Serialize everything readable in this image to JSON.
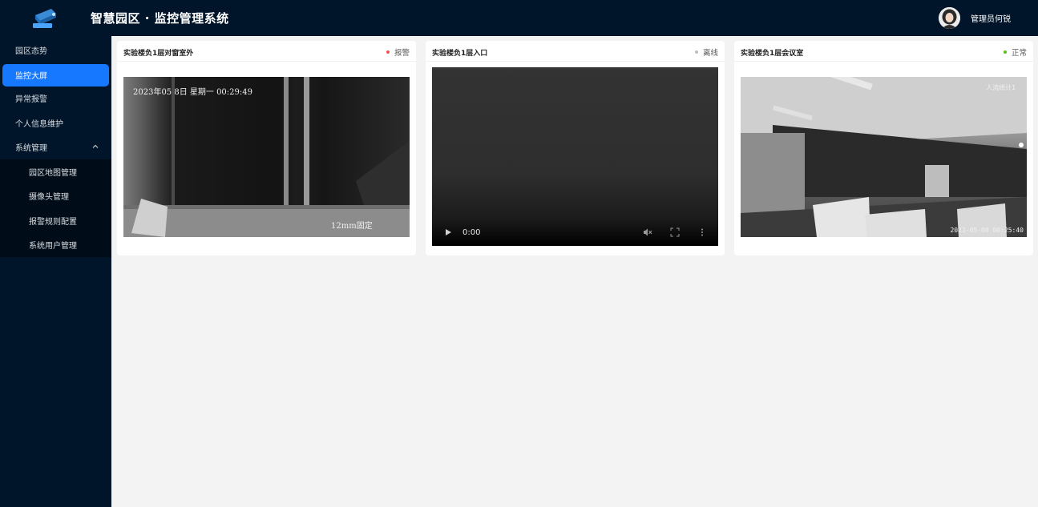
{
  "header": {
    "title": "智慧园区 · 监控管理系统",
    "user_name": "管理员何锐"
  },
  "sidebar": {
    "items": [
      {
        "label": "园区态势"
      },
      {
        "label": "监控大屏"
      },
      {
        "label": "异常报警"
      },
      {
        "label": "个人信息维护"
      },
      {
        "label": "系统管理"
      }
    ],
    "submenu": [
      {
        "label": "园区地图管理"
      },
      {
        "label": "摄像头管理"
      },
      {
        "label": "报警规则配置"
      },
      {
        "label": "系统用户管理"
      }
    ]
  },
  "cameras": [
    {
      "title": "实验楼负1层对窗室外",
      "status": "报警",
      "status_color": "#ff4d4f",
      "osd_top": "2023年05    8日  星期一  00:29:49",
      "osd_bottom": "12mm固定"
    },
    {
      "title": "实验楼负1层入口",
      "status": "离线",
      "status_color": "#bfbfbf",
      "time": "0:00"
    },
    {
      "title": "实验楼负1层会议室",
      "status": "正常",
      "status_color": "#52c41a",
      "osd_top": "人流统计1",
      "osd_bottom": "2023-05-08 00:25:40"
    }
  ],
  "colors": {
    "header_bg": "#001529",
    "active_menu": "#1677ff"
  }
}
